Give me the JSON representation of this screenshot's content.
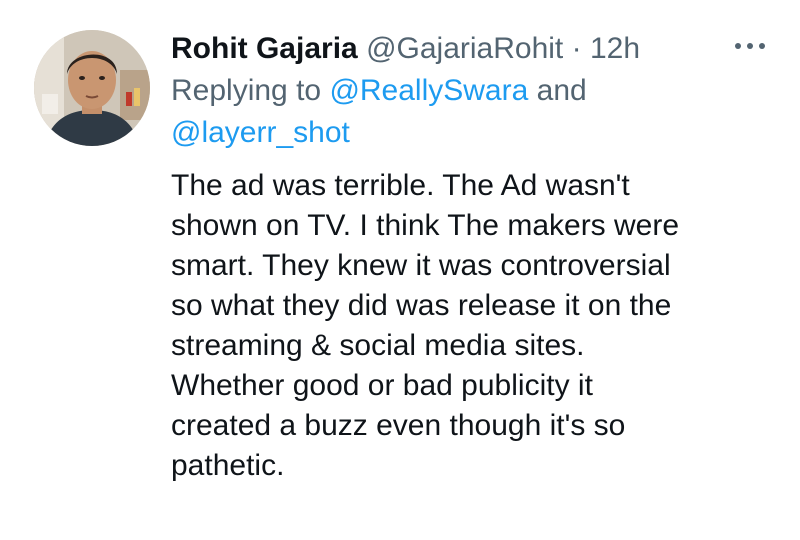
{
  "tweet": {
    "author": {
      "name": "Rohit Gajaria",
      "handle": "@GajariaRohit",
      "separator": "·",
      "time": "12h"
    },
    "more_icon": "more-horizontal-icon",
    "reply": {
      "prefix": "Replying to ",
      "mention_1": "@ReallySwara",
      "conjunction": " and",
      "mention_2": "@layerr_shot"
    },
    "text_lines": [
      "The ad was terrible. The Ad wasn't",
      "shown on TV. I think The makers were",
      "smart. They knew it was controversial",
      "so what they did was release it on the",
      "streaming & social media sites.",
      "Whether good or bad publicity it",
      "created a buzz even though it's so",
      "pathetic."
    ]
  },
  "colors": {
    "text_primary": "#0f1419",
    "text_secondary": "#536471",
    "link": "#1d9bf0",
    "background": "#ffffff"
  }
}
